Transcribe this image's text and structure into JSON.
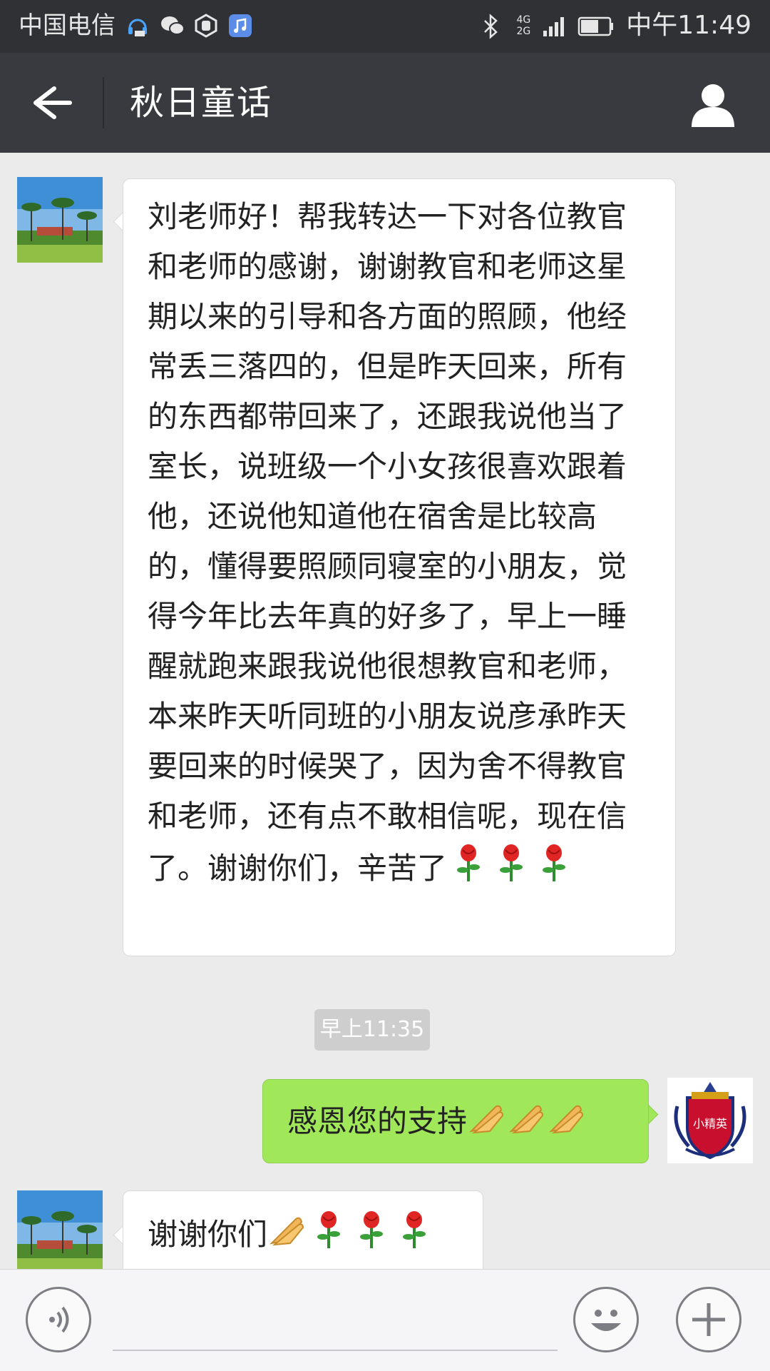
{
  "status_bar": {
    "carrier": "中国电信",
    "network": "4G",
    "network2": "2G",
    "time": "中午11:49"
  },
  "nav": {
    "title": "秋日童话"
  },
  "messages": [
    {
      "sender": "other",
      "text": "刘老师好！帮我转达一下对各位教官和老师的感谢，谢谢教官和老师这星期以来的引导和各方面的照顾，他经常丢三落四的，但是昨天回来，所有的东西都带回来了，还跟我说他当了室长，说班级一个小女孩很喜欢跟着他，还说他知道他在宿舍是比较高的，懂得要照顾同寝室的小朋友，觉得今年比去年真的好多了，早上一睡醒就跑来跟我说他很想教官和老师，本来昨天听同班的小朋友说彦承昨天要回来的时候哭了，因为舍不得教官和老师，还有点不敢相信呢，现在信了。谢谢你们，辛苦了"
    },
    {
      "timestamp": "早上11:35"
    },
    {
      "sender": "me",
      "text": "感恩您的支持",
      "avatar_text": "小精英"
    },
    {
      "sender": "other",
      "text": "谢谢你们"
    }
  ],
  "input": {
    "placeholder": ""
  }
}
